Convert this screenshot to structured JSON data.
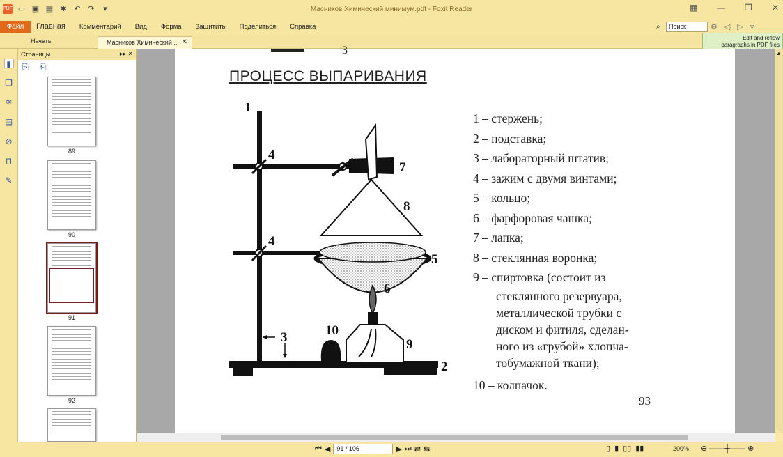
{
  "window": {
    "title": "Масников Химический минимум.pdf - Foxit Reader"
  },
  "ribbon": {
    "file_button": "Файл",
    "menu": [
      "Главная",
      "Комментарий",
      "Вид",
      "Форма",
      "Защитить",
      "Поделиться",
      "Справка"
    ],
    "search_placeholder": "Поиск"
  },
  "tabs": {
    "start": "Начать",
    "document": "Масников Химический ..."
  },
  "reflow_banner": {
    "line1": "Edit and reflow",
    "line2": "paragraphs in PDF files"
  },
  "panel": {
    "title": "Страницы",
    "thumb_labels": [
      "89",
      "90",
      "91",
      "92"
    ]
  },
  "page": {
    "title": "ПРОЦЕСС ВЫПАРИВАНИЯ",
    "top_fragment": "3",
    "diagram_labels": [
      "1",
      "2",
      "3",
      "4",
      "4",
      "5",
      "6",
      "7",
      "8",
      "9",
      "10"
    ],
    "legend": [
      "1 – стержень;",
      "2 – подставка;",
      "3 – лабораторный штатив;",
      "4 – зажим с двумя винтами;",
      "5 – кольцо;",
      "6 – фарфоровая чашка;",
      "7 – лапка;",
      "8 – стеклянная воронка;",
      "9 – спиртовка (состоит из"
    ],
    "legend_cont": [
      "стеклянного резервуара,",
      "металлической трубки с",
      "диском и фитиля, сделан-",
      "ного из «грубой» хлопча-",
      "тобумажной ткани);"
    ],
    "legend_last": "10 – колпачок.",
    "page_number": "93"
  },
  "status": {
    "page_box": "91 / 106",
    "zoom": "200%"
  },
  "colors": {
    "chrome": "#f7e6a2",
    "file_button": "#e06a1a",
    "doc_background": "#a8a8a8"
  }
}
